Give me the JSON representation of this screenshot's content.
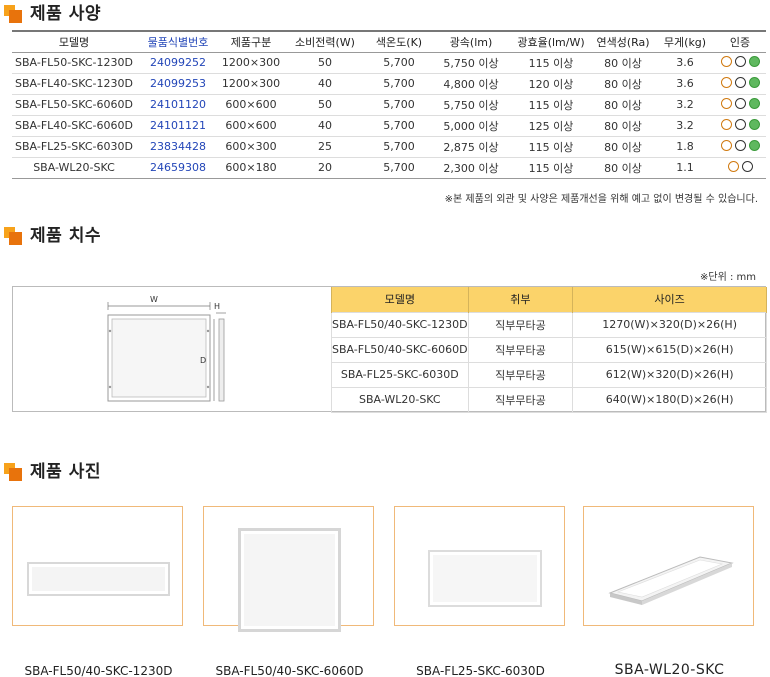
{
  "spec_section": {
    "title": "제품 사양",
    "headers": [
      "모델명",
      "물품식별번호",
      "제품구분",
      "소비전력(W)",
      "색온도(K)",
      "광속(lm)",
      "광효율(lm/W)",
      "연색성(Ra)",
      "무게(kg)",
      "인증"
    ],
    "rows": [
      [
        "SBA-FL50-SKC-1230D",
        "24099252",
        "1200×300",
        "50",
        "5,700",
        "5,750 이상",
        "115 이상",
        "80 이상",
        "3.6"
      ],
      [
        "SBA-FL40-SKC-1230D",
        "24099253",
        "1200×300",
        "40",
        "5,700",
        "4,800 이상",
        "120 이상",
        "80 이상",
        "3.6"
      ],
      [
        "SBA-FL50-SKC-6060D",
        "24101120",
        "600×600",
        "50",
        "5,700",
        "5,750 이상",
        "115 이상",
        "80 이상",
        "3.2"
      ],
      [
        "SBA-FL40-SKC-6060D",
        "24101121",
        "600×600",
        "40",
        "5,700",
        "5,000 이상",
        "125 이상",
        "80 이상",
        "3.2"
      ],
      [
        "SBA-FL25-SKC-6030D",
        "23834428",
        "600×300",
        "25",
        "5,700",
        "2,875 이상",
        "115 이상",
        "80 이상",
        "1.8"
      ],
      [
        "SBA-WL20-SKC",
        "24659308",
        "600×180",
        "20",
        "5,700",
        "2,300 이상",
        "115 이상",
        "80 이상",
        "1.1"
      ]
    ],
    "note": "※본 제품의 외관 및 사양은 제품개선을 위해 예고 없이 변경될 수 있습니다."
  },
  "dim_section": {
    "title": "제품 치수",
    "unit": "※단위 : mm",
    "drawing_labels": {
      "w": "W",
      "h": "H",
      "d": "D"
    },
    "headers": [
      "모델명",
      "취부",
      "사이즈"
    ],
    "rows": [
      [
        "SBA-FL50/40-SKC-1230D",
        "직부무타공",
        "1270(W)×320(D)×26(H)"
      ],
      [
        "SBA-FL50/40-SKC-6060D",
        "직부무타공",
        "615(W)×615(D)×26(H)"
      ],
      [
        "SBA-FL25-SKC-6030D",
        "직부무타공",
        "612(W)×320(D)×26(H)"
      ],
      [
        "SBA-WL20-SKC",
        "직부무타공",
        "640(W)×180(D)×26(H)"
      ]
    ]
  },
  "photo_section": {
    "title": "제품 사진",
    "captions": [
      "SBA-FL50/40-SKC-1230D",
      "SBA-FL50/40-SKC-6060D",
      "SBA-FL25-SKC-6030D",
      "SBA-WL20-SKC"
    ]
  },
  "colors": {
    "accent": "#f7a21b",
    "accent_dark": "#e8730c",
    "code_blue": "#2346b8",
    "header_yellow": "#fbd36a"
  }
}
